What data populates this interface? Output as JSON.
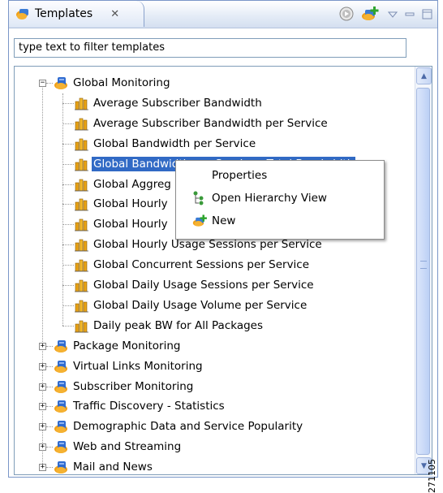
{
  "view": {
    "tab_label": "Templates",
    "tab_close": "✕",
    "toolbar_icons": [
      "run-icon",
      "new-template-icon",
      "view-menu-icon",
      "minimize-icon",
      "maximize-icon"
    ]
  },
  "filter": {
    "value": "type text to filter templates"
  },
  "tree": {
    "root": {
      "label": "Global Monitoring",
      "expanded": true,
      "children": [
        "Average Subscriber Bandwidth",
        "Average Subscriber Bandwidth per Service",
        "Global Bandwidth per Service",
        "Global Bandwidth per Service - Total Bandwidth",
        "Global Aggreg",
        "Global Hourly",
        "Global Hourly",
        "Global Hourly Usage Sessions per Service",
        "Global Concurrent Sessions per Service",
        "Global Daily Usage Sessions per Service",
        "Global Daily Usage Volume per Service",
        "Daily peak BW for All Packages"
      ],
      "selected_child": 3
    },
    "collapsed_groups": [
      "Package Monitoring",
      "Virtual Links Monitoring",
      "Subscriber Monitoring",
      "Traffic Discovery - Statistics",
      "Demographic Data and Service Popularity",
      "Web and Streaming",
      "Mail and News"
    ],
    "expand_symbol": "+",
    "collapse_symbol": "−"
  },
  "context_menu": {
    "items": [
      {
        "label": "Properties",
        "icon": ""
      },
      {
        "label": "Open Hierarchy View",
        "icon": "hierarchy-icon"
      },
      {
        "label": "New",
        "icon": "new-template-icon"
      }
    ]
  },
  "watermark": "271105"
}
